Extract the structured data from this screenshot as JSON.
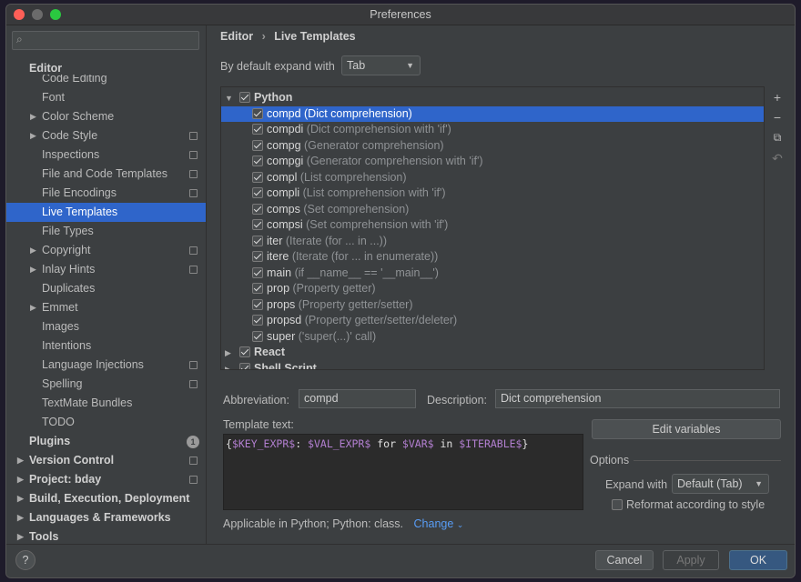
{
  "window": {
    "title": "Preferences"
  },
  "sidebar": {
    "search_placeholder": "",
    "header": "Editor",
    "items": [
      {
        "label": "Code Editing",
        "indent": 2,
        "arrow": false,
        "copy": false
      },
      {
        "label": "Font",
        "indent": 2,
        "arrow": false,
        "copy": false
      },
      {
        "label": "Color Scheme",
        "indent": 2,
        "arrow": true,
        "copy": false
      },
      {
        "label": "Code Style",
        "indent": 2,
        "arrow": true,
        "copy": true
      },
      {
        "label": "Inspections",
        "indent": 2,
        "arrow": false,
        "copy": true
      },
      {
        "label": "File and Code Templates",
        "indent": 2,
        "arrow": false,
        "copy": true
      },
      {
        "label": "File Encodings",
        "indent": 2,
        "arrow": false,
        "copy": true
      },
      {
        "label": "Live Templates",
        "indent": 2,
        "arrow": false,
        "copy": false,
        "selected": true
      },
      {
        "label": "File Types",
        "indent": 2,
        "arrow": false,
        "copy": false
      },
      {
        "label": "Copyright",
        "indent": 2,
        "arrow": true,
        "copy": true
      },
      {
        "label": "Inlay Hints",
        "indent": 2,
        "arrow": true,
        "copy": true
      },
      {
        "label": "Duplicates",
        "indent": 2,
        "arrow": false,
        "copy": false
      },
      {
        "label": "Emmet",
        "indent": 2,
        "arrow": true,
        "copy": false
      },
      {
        "label": "Images",
        "indent": 2,
        "arrow": false,
        "copy": false
      },
      {
        "label": "Intentions",
        "indent": 2,
        "arrow": false,
        "copy": false
      },
      {
        "label": "Language Injections",
        "indent": 2,
        "arrow": false,
        "copy": true
      },
      {
        "label": "Spelling",
        "indent": 2,
        "arrow": false,
        "copy": true
      },
      {
        "label": "TextMate Bundles",
        "indent": 2,
        "arrow": false,
        "copy": false
      },
      {
        "label": "TODO",
        "indent": 2,
        "arrow": false,
        "copy": false
      },
      {
        "label": "Plugins",
        "indent": 1,
        "arrow": false,
        "copy": false,
        "bold": true,
        "badge": "1"
      },
      {
        "label": "Version Control",
        "indent": 1,
        "arrow": true,
        "copy": true,
        "bold": true
      },
      {
        "label": "Project: bday",
        "indent": 1,
        "arrow": true,
        "copy": true,
        "bold": true
      },
      {
        "label": "Build, Execution, Deployment",
        "indent": 1,
        "arrow": true,
        "copy": false,
        "bold": true
      },
      {
        "label": "Languages & Frameworks",
        "indent": 1,
        "arrow": true,
        "copy": false,
        "bold": true
      },
      {
        "label": "Tools",
        "indent": 1,
        "arrow": true,
        "copy": false,
        "bold": true
      }
    ]
  },
  "breadcrumb": {
    "parent": "Editor",
    "separator": "›",
    "current": "Live Templates"
  },
  "expand_default": {
    "label": "By default expand with",
    "value": "Tab"
  },
  "templates": {
    "groups": [
      {
        "name": "Python",
        "checked": true,
        "expanded": true,
        "items": [
          {
            "abbr": "compd",
            "desc": "(Dict comprehension)",
            "selected": true
          },
          {
            "abbr": "compdi",
            "desc": "(Dict comprehension with 'if')"
          },
          {
            "abbr": "compg",
            "desc": "(Generator comprehension)"
          },
          {
            "abbr": "compgi",
            "desc": "(Generator comprehension with 'if')"
          },
          {
            "abbr": "compl",
            "desc": "(List comprehension)"
          },
          {
            "abbr": "compli",
            "desc": "(List comprehension with 'if')"
          },
          {
            "abbr": "comps",
            "desc": "(Set comprehension)"
          },
          {
            "abbr": "compsi",
            "desc": "(Set comprehension with 'if')"
          },
          {
            "abbr": "iter",
            "desc": "(Iterate (for ... in ...))"
          },
          {
            "abbr": "itere",
            "desc": "(Iterate (for ... in enumerate))"
          },
          {
            "abbr": "main",
            "desc": "(if __name__ == '__main__')"
          },
          {
            "abbr": "prop",
            "desc": "(Property getter)"
          },
          {
            "abbr": "props",
            "desc": "(Property getter/setter)"
          },
          {
            "abbr": "propsd",
            "desc": "(Property getter/setter/deleter)"
          },
          {
            "abbr": "super",
            "desc": "('super(...)' call)"
          }
        ]
      },
      {
        "name": "React",
        "checked": true,
        "expanded": false,
        "items": []
      },
      {
        "name": "Shell Script",
        "checked": true,
        "expanded": false,
        "items": []
      }
    ]
  },
  "editor": {
    "abbreviation_label": "Abbreviation:",
    "abbreviation": "compd",
    "description_label": "Description:",
    "description": "Dict comprehension",
    "template_label": "Template text:",
    "template_parts": [
      [
        "{",
        ""
      ],
      [
        "$KEY_EXPR$",
        "v"
      ],
      [
        ": ",
        ""
      ],
      [
        "$VAL_EXPR$",
        "v"
      ],
      [
        " for ",
        ""
      ],
      [
        "$VAR$",
        "v"
      ],
      [
        " in ",
        ""
      ],
      [
        "$ITERABLE$",
        "v"
      ],
      [
        "}",
        ""
      ]
    ],
    "edit_variables": "Edit variables",
    "options_label": "Options",
    "expand_with_label": "Expand with",
    "expand_with": "Default (Tab)",
    "reformat_label": "Reformat according to style",
    "reformat": false,
    "applicable": "Applicable in Python; Python: class.",
    "change": "Change"
  },
  "footer": {
    "help": "?",
    "cancel": "Cancel",
    "apply": "Apply",
    "ok": "OK"
  },
  "colors": {
    "accent": "#2f65ca",
    "variable": "#b27fd0",
    "link": "#589df6"
  }
}
